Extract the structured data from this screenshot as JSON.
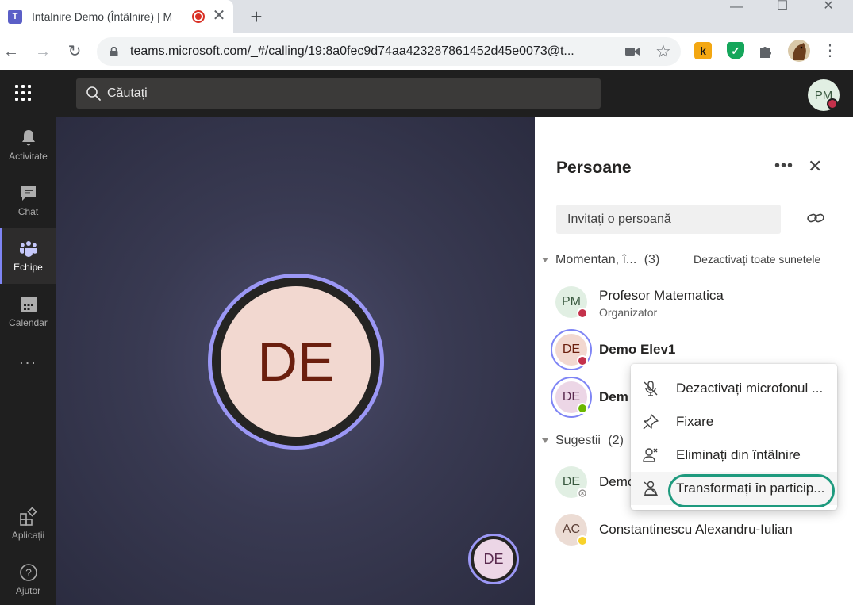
{
  "browser": {
    "tab_title": "Intalnire Demo (Întâlnire) | M",
    "tab_favicon": "T",
    "new_tab": "+",
    "url": "teams.microsoft.com/_#/calling/19:8a0fec9d74aa423287861452d45e0073@t...",
    "minimize": "—",
    "maximize": "☐",
    "close": "✕",
    "extensions": [
      {
        "name": "k-extension-icon",
        "glyph": "k",
        "bg": "#f3a712",
        "fg": "#1a1a1a"
      },
      {
        "name": "shield-extension-icon",
        "glyph": "✓",
        "bg": "#15a65b",
        "fg": "#ffffff"
      }
    ]
  },
  "teams": {
    "search_placeholder": "Căutați",
    "me_initials": "PM",
    "rail": [
      {
        "key": "activitate",
        "label": "Activitate"
      },
      {
        "key": "chat",
        "label": "Chat"
      },
      {
        "key": "echipe",
        "label": "Echipe"
      },
      {
        "key": "calendar",
        "label": "Calendar"
      },
      {
        "key": "more",
        "label": "..."
      },
      {
        "key": "aplicatii",
        "label": "Aplicații"
      },
      {
        "key": "ajutor",
        "label": "Ajutor"
      }
    ]
  },
  "stage": {
    "main_initials": "DE",
    "self_initials": "DE"
  },
  "panel": {
    "title": "Persoane",
    "more": "•••",
    "close": "✕",
    "invite_placeholder": "Invitați o persoană",
    "in_meeting_header": "Momentan, î...",
    "in_meeting_count": "(3)",
    "mute_all": "Dezactivați toate sunetele",
    "suggestions_header": "Sugestii",
    "suggestions_count": "(2)",
    "people": [
      {
        "initials": "PM",
        "name": "Profesor Matematica",
        "role": "Organizator",
        "status": "busy"
      },
      {
        "initials": "DE",
        "name": "Demo Elev1",
        "status": "busy"
      },
      {
        "initials": "DE",
        "name": "Dem",
        "status": "available"
      }
    ],
    "suggested": [
      {
        "initials": "DE",
        "name": "Demo",
        "status": "offline"
      },
      {
        "initials": "AC",
        "name": "Constantinescu Alexandru-Iulian",
        "status": "away"
      }
    ]
  },
  "context_menu": {
    "items": [
      {
        "label": "Dezactivați microfonul ...",
        "icon": "mic-off-icon"
      },
      {
        "label": "Fixare",
        "icon": "pin-icon"
      },
      {
        "label": "Eliminați din întâlnire",
        "icon": "remove-person-icon"
      },
      {
        "label": "Transformați în particip...",
        "icon": "make-attendee-icon"
      }
    ]
  },
  "colors": {
    "accent": "#7f85f5",
    "busy": "#c4314b",
    "available": "#6bb700",
    "away": "#f8d22a",
    "highlight": "#1e9a7e"
  }
}
